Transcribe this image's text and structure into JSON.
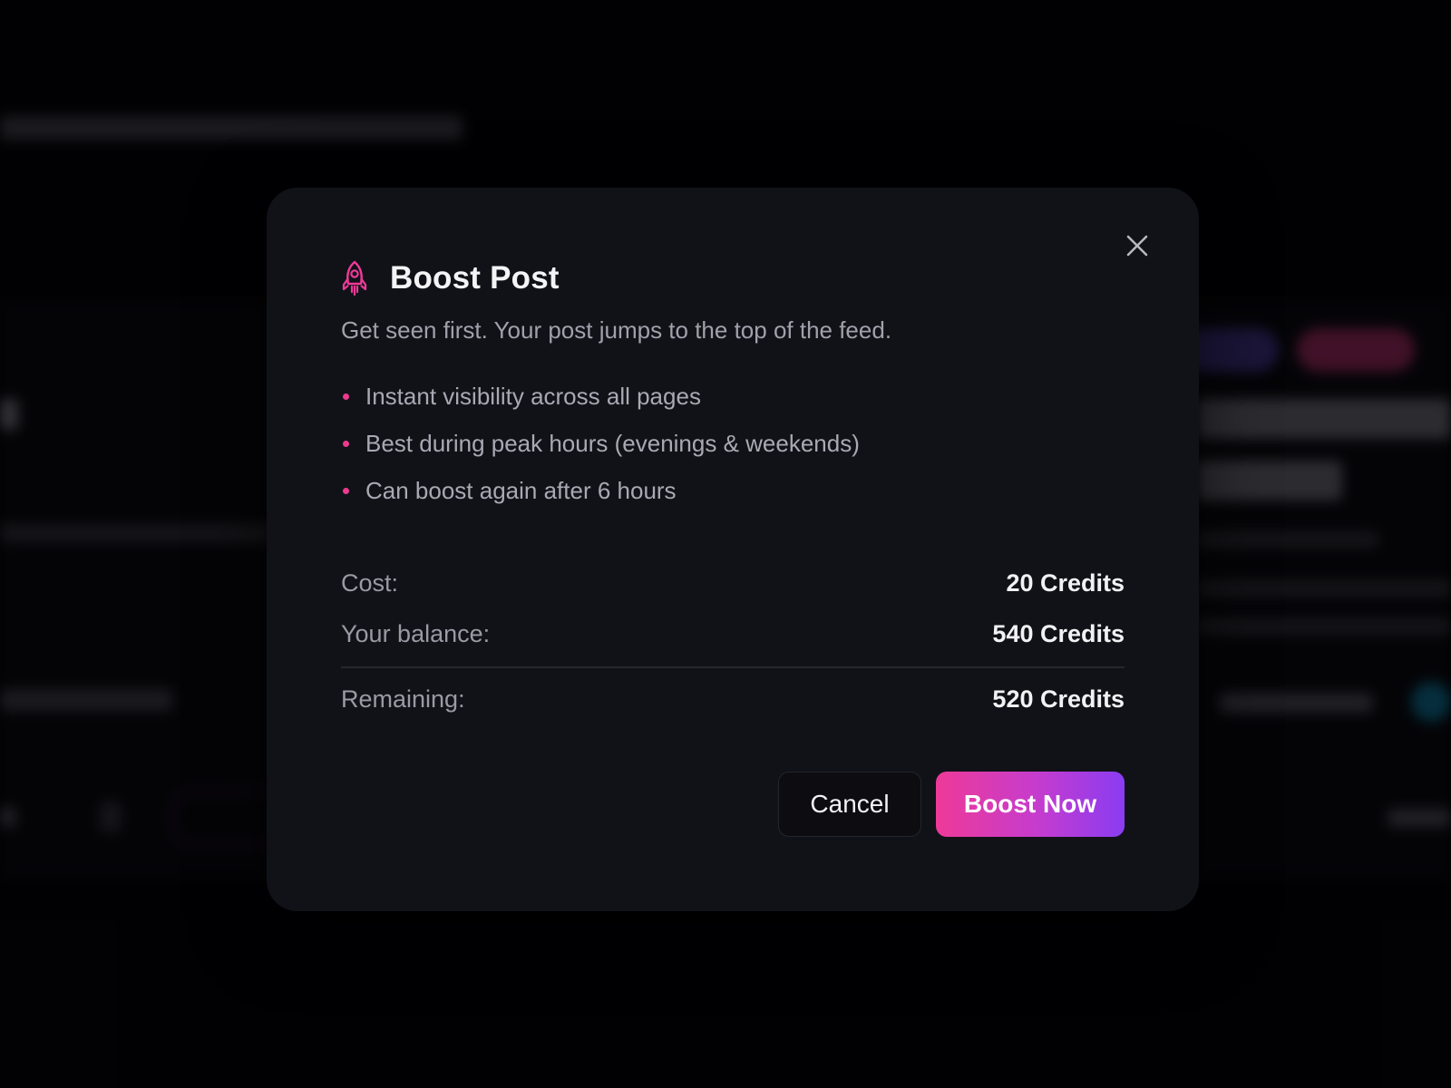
{
  "modal": {
    "title": "Boost Post",
    "subtitle": "Get seen first. Your post jumps to the top of the feed.",
    "features": [
      "Instant visibility across all pages",
      "Best during peak hours (evenings & weekends)",
      "Can boost again after 6 hours"
    ],
    "cost": {
      "cost_label": "Cost:",
      "cost_value": "20 Credits",
      "balance_label": "Your balance:",
      "balance_value": "540 Credits",
      "remaining_label": "Remaining:",
      "remaining_value": "520 Credits"
    },
    "actions": {
      "cancel_label": "Cancel",
      "boost_label": "Boost Now"
    },
    "icons": {
      "title_icon": "rocket-icon",
      "close_icon": "close-icon"
    }
  },
  "colors": {
    "accent_pink": "#ec3a8c",
    "accent_purple": "#8a3cf2",
    "modal_bg": "#111218",
    "page_bg": "#030306"
  }
}
